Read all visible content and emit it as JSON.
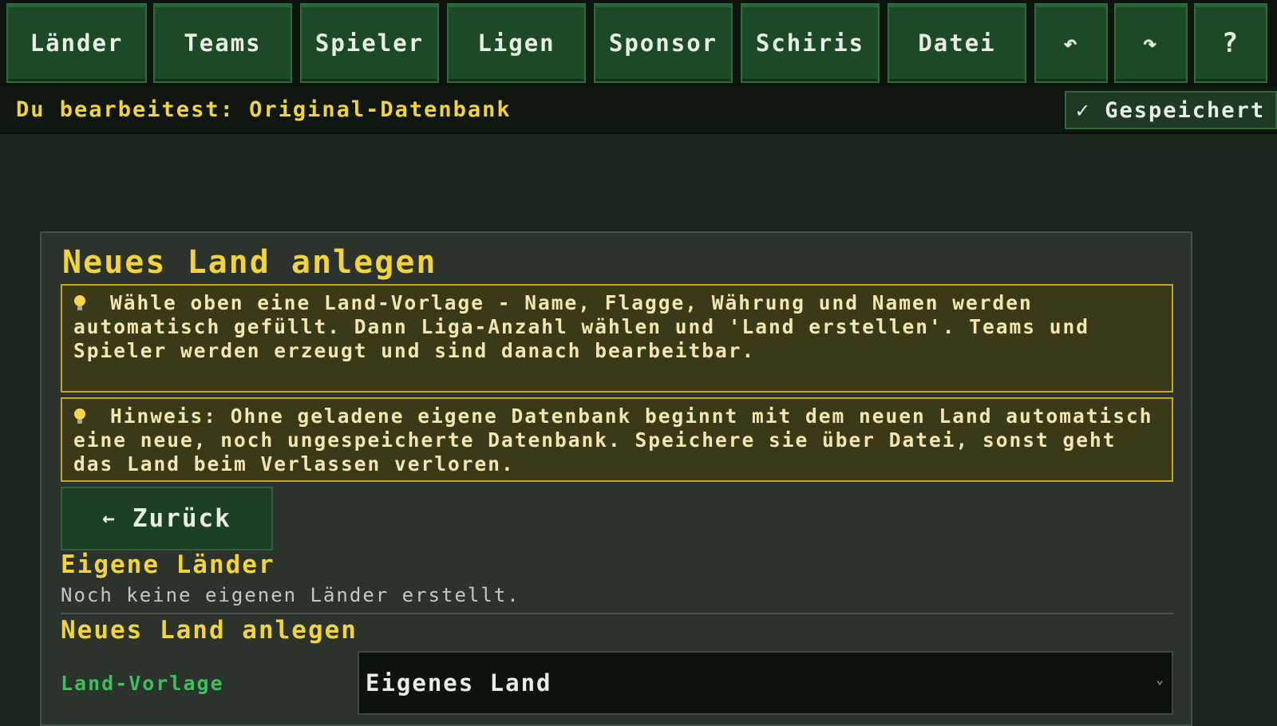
{
  "nav": {
    "items": [
      {
        "label": "Länder"
      },
      {
        "label": "Teams"
      },
      {
        "label": "Spieler"
      },
      {
        "label": "Ligen"
      },
      {
        "label": "Sponsor"
      },
      {
        "label": "Schiris"
      },
      {
        "label": "Datei"
      }
    ],
    "undo_icon": "↶",
    "redo_icon": "↷",
    "help_label": "?"
  },
  "status": {
    "editing_text": "Du bearbeitest: Original-Datenbank",
    "saved_check": "✓",
    "saved_label": "Gespeichert"
  },
  "panel": {
    "title": "Neues Land anlegen",
    "notes": [
      {
        "text": "Wähle oben eine Land-Vorlage - Name, Flagge, Währung und Namen werden automatisch gefüllt. Dann Liga-Anzahl wählen und 'Land erstellen'. Teams und Spieler werden erzeugt und sind danach bearbeitbar."
      },
      {
        "text": "Hinweis: Ohne geladene eigene Datenbank beginnt mit dem neuen Land automatisch eine neue, noch ungespeicherte Datenbank. Speichere sie über Datei, sonst geht das Land beim Verlassen verloren."
      }
    ],
    "back_arrow": "←",
    "back_label": "Zurück",
    "own_countries_title": "Eigene Länder",
    "own_countries_empty": "Noch keine eigenen Länder erstellt.",
    "new_country_title": "Neues Land anlegen",
    "template_label": "Land-Vorlage",
    "template_value": "Eigenes Land"
  },
  "colors": {
    "accent_yellow": "#f2d33a",
    "nav_green": "#1c4a26",
    "label_green": "#3fbf5c",
    "note_border": "#c9a520"
  }
}
